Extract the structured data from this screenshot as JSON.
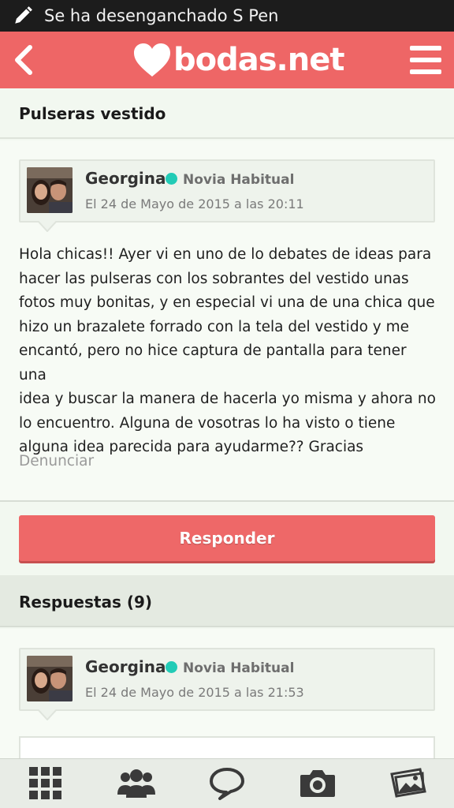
{
  "status_bar": {
    "notification_text": "Se ha desenganchado S Pen",
    "icon": "pen-icon"
  },
  "app_bar": {
    "brand": "bodas.net",
    "back_icon": "chevron-left-icon",
    "menu_icon": "hamburger-menu-icon",
    "color": "#ee6666"
  },
  "topic": {
    "title": "Pulseras vestido"
  },
  "post": {
    "author": {
      "name": "Georgina",
      "rank": "Novia Habitual",
      "date": "El 24 de Mayo de 2015 a las 20:11",
      "online_color": "#22cbb6"
    },
    "lines": [
      "Hola chicas!! Ayer vi en uno de lo debates de ideas para",
      "hacer las pulseras con los sobrantes del vestido unas",
      "fotos muy bonitas, y en especial vi una de una chica que",
      "hizo un brazalete forrado con la tela del vestido y me",
      "encantó, pero no hice captura de pantalla para tener una",
      "idea y buscar la manera de hacerla yo misma y ahora no",
      "lo encuentro. Alguna de vosotras lo ha visto o tiene",
      "alguna idea parecida para ayudarme?? Gracias"
    ],
    "report_label": "Denunciar"
  },
  "reply_button": {
    "label": "Responder"
  },
  "answers": {
    "title": "Respuestas (9)",
    "first": {
      "name": "Georgina",
      "rank": "Novia Habitual",
      "date": "El 24 de Mayo de 2015 a las 21:53"
    }
  },
  "bottom_nav": {
    "tabs": [
      {
        "icon": "grid-icon"
      },
      {
        "icon": "community-icon"
      },
      {
        "icon": "chat-bubble-icon"
      },
      {
        "icon": "camera-icon"
      },
      {
        "icon": "photos-icon"
      }
    ]
  }
}
